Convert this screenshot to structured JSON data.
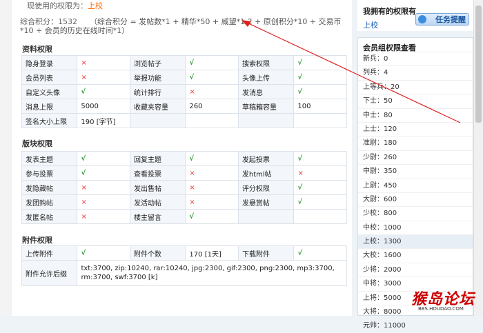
{
  "current": {
    "label": "现使用的权限为：",
    "value": "上校"
  },
  "score": {
    "label": "综合积分：1532",
    "formula": "（综合积分 = 发帖数*1 + 精华*50 + 威望*1.2 + 原创积分*10 + 交易币*10 + 会员的历史在线时间*1）"
  },
  "sections": {
    "profile": {
      "title": "资料权限",
      "rows": [
        [
          {
            "k": "隐身登录",
            "v": "×"
          },
          {
            "k": "浏览帖子",
            "v": "√"
          },
          {
            "k": "搜索权限",
            "v": "√"
          }
        ],
        [
          {
            "k": "会员列表",
            "v": "×"
          },
          {
            "k": "举报功能",
            "v": "√"
          },
          {
            "k": "头像上传",
            "v": "√"
          }
        ],
        [
          {
            "k": "自定义头像",
            "v": "√"
          },
          {
            "k": "统计排行",
            "v": "×"
          },
          {
            "k": "发消息",
            "v": "√"
          }
        ],
        [
          {
            "k": "消息上限",
            "v": "5000"
          },
          {
            "k": "收藏夹容量",
            "v": "260"
          },
          {
            "k": "草稿箱容量",
            "v": "100"
          }
        ],
        [
          {
            "k": "签名大小上限",
            "v": "190 [字节]"
          },
          {
            "k": "",
            "v": ""
          },
          {
            "k": "",
            "v": ""
          }
        ]
      ]
    },
    "board": {
      "title": "版块权限",
      "rows": [
        [
          {
            "k": "发表主题",
            "v": "√"
          },
          {
            "k": "回复主题",
            "v": "√"
          },
          {
            "k": "发起投票",
            "v": "√"
          }
        ],
        [
          {
            "k": "参与投票",
            "v": "√"
          },
          {
            "k": "查看投票",
            "v": "×"
          },
          {
            "k": "发html帖",
            "v": "×"
          }
        ],
        [
          {
            "k": "发隐藏帖",
            "v": "×"
          },
          {
            "k": "发出售帖",
            "v": "×"
          },
          {
            "k": "评分权限",
            "v": "√"
          }
        ],
        [
          {
            "k": "发团购帖",
            "v": "×"
          },
          {
            "k": "发活动帖",
            "v": "×"
          },
          {
            "k": "发悬赏帖",
            "v": "√"
          }
        ],
        [
          {
            "k": "发匿名帖",
            "v": "×"
          },
          {
            "k": "楼主留言",
            "v": "√"
          },
          {
            "k": "",
            "v": ""
          }
        ]
      ]
    },
    "attach": {
      "title": "附件权限",
      "row1": [
        {
          "k": "上传附件",
          "v": "√"
        },
        {
          "k": "附件个数",
          "v": "170 [1天]"
        },
        {
          "k": "下载附件",
          "v": "√"
        }
      ],
      "types_label": "附件允许后缀",
      "types_value": "txt:3700, zip:10240, rar:10240, jpg:2300, gif:2300, png:2300, mp3:3700, rm:3700, swf:3700 [k]"
    }
  },
  "sidebar": {
    "mine_title": "我拥有的权限有",
    "mine_value": "上校",
    "task_button": "任务提醒",
    "group_title": "会员组权限查看",
    "ranks": [
      "新兵：0",
      "列兵：4",
      "上等兵：20",
      "下士：50",
      "中士：80",
      "上士：120",
      "准尉：180",
      "少尉：260",
      "中尉：350",
      "上尉：450",
      "大尉：600",
      "少校：800",
      "中校：1000",
      "上校：1300",
      "大校：1600",
      "少将：2000",
      "中将：3000",
      "上将：5000",
      "大将：8000",
      "元帅：11000"
    ],
    "selected_index": 13
  },
  "watermark": {
    "text": "猴岛论坛",
    "url": "BBS.HOUDAO.COM"
  },
  "colors": {
    "yes": "#2a9b2a",
    "no": "#ee3333",
    "arrow": "#e02020",
    "link": "#1a5fb4"
  }
}
